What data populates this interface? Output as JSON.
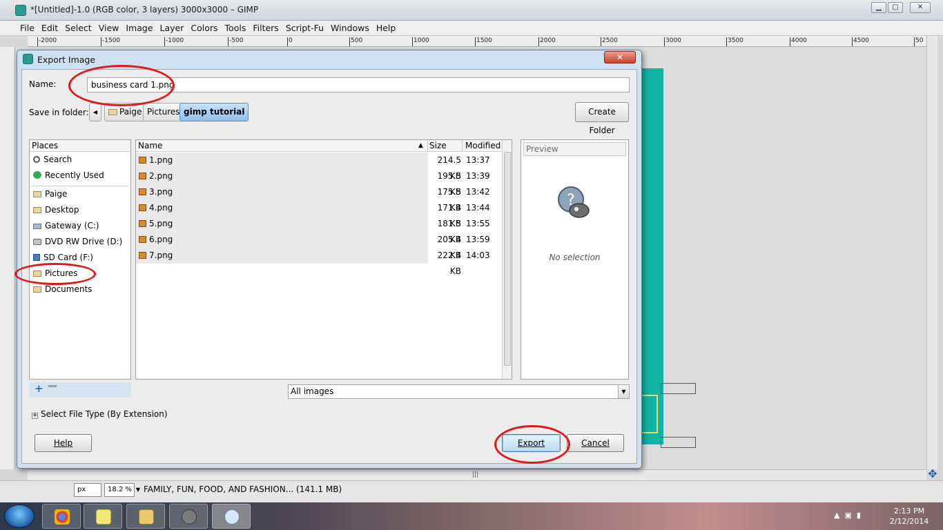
{
  "window": {
    "title": "*[Untitled]-1.0 (RGB color, 3 layers) 3000x3000 – GIMP",
    "min_glyph": "▁",
    "max_glyph": "▢",
    "close_glyph": "✕"
  },
  "menu": [
    "File",
    "Edit",
    "Select",
    "View",
    "Image",
    "Layer",
    "Colors",
    "Tools",
    "Filters",
    "Script-Fu",
    "Windows",
    "Help"
  ],
  "ruler_ticks": [
    "-2000",
    "-1500",
    "-1000",
    "-500",
    "0",
    "500",
    "1000",
    "1500",
    "2000",
    "2500",
    "3000",
    "3500",
    "4000",
    "4500",
    "50"
  ],
  "statusbar": {
    "unit": "px",
    "zoom": "18.2 %",
    "text": "FAMILY, FUN, FOOD, AND FASHION... (141.1 MB)"
  },
  "dialog": {
    "title": "Export Image",
    "close_glyph": "✕",
    "name_label": "Name:",
    "name_value": "business card 1.png",
    "save_in_label": "Save in folder:",
    "breadcrumbs": [
      "Paige",
      "Pictures",
      "gimp tutorial"
    ],
    "create_folder": "Create Folder",
    "places_header": "Places",
    "places_top": [
      "Search",
      "Recently Used"
    ],
    "places_bottom": [
      "Paige",
      "Desktop",
      "Gateway (C:)",
      "DVD RW Drive (D:)",
      "SD Card (F:)",
      "Pictures",
      "Documents"
    ],
    "columns": {
      "name": "Name",
      "size": "Size",
      "modified": "Modified"
    },
    "files": [
      {
        "name": "1.png",
        "size": "214.5 KB",
        "modified": "13:37"
      },
      {
        "name": "2.png",
        "size": "195.5 KB",
        "modified": "13:39"
      },
      {
        "name": "3.png",
        "size": "175.5 KB",
        "modified": "13:42"
      },
      {
        "name": "4.png",
        "size": "171.4 KB",
        "modified": "13:44"
      },
      {
        "name": "5.png",
        "size": "181.5 KB",
        "modified": "13:55"
      },
      {
        "name": "6.png",
        "size": "205.4 KB",
        "modified": "13:59"
      },
      {
        "name": "7.png",
        "size": "222.4 KB",
        "modified": "14:03"
      }
    ],
    "preview_label": "Preview",
    "no_selection": "No selection",
    "filter": "All images",
    "filetype_expander": "Select File Type (By Extension)",
    "help": "Help",
    "export": "Export",
    "cancel": "Cancel"
  },
  "taskbar": {
    "time": "2:13 PM",
    "date": "2/12/2014",
    "apps": [
      "chrome-icon",
      "sticky-notes-icon",
      "file-explorer-icon",
      "gimp-icon",
      "paint-icon"
    ]
  },
  "colors": {
    "canvas_fill": "#11b3a3",
    "annotation_ring": "#e01818",
    "dialog_frame": "#cfe0f1"
  }
}
